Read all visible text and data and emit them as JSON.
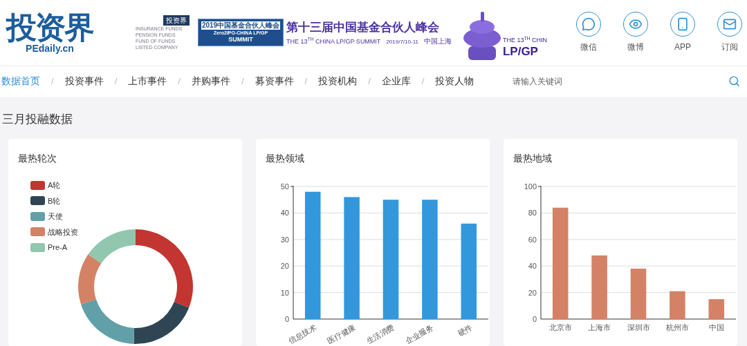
{
  "header": {
    "logo": {
      "name": "投资界",
      "site": "PEdaily.cn"
    },
    "partner": {
      "badge": "投资界",
      "lines": [
        "INSURANCE FUNDS",
        "PENSION FUNDS",
        "FUND OF FUNDS",
        "LISTED COMPANY"
      ]
    },
    "summit": {
      "badge_top": "2019中国基金合伙人峰会",
      "badge_mid": "Zero2IPO-CHINA LP/GP",
      "badge_bottom": "SUMMIT",
      "title": "第十三届中国基金合伙人峰会",
      "subtitle": "THE 13$^{TH}$ CHINA LP/GP SUMMIT",
      "date": "2019/7/10-11",
      "place": "中国上海"
    },
    "temple": {
      "line1": "THE 13$^{TH}$ CHIN",
      "line2": "LP/GP"
    },
    "links": [
      {
        "kind": "wechat",
        "label": "微信"
      },
      {
        "kind": "weibo",
        "label": "微博"
      },
      {
        "kind": "app",
        "label": "APP"
      },
      {
        "kind": "mail",
        "label": "订阅"
      }
    ]
  },
  "nav": {
    "items": [
      {
        "label": "数据首页",
        "selected": true
      },
      {
        "label": "投资事件",
        "selected": false
      },
      {
        "label": "上市事件",
        "selected": false
      },
      {
        "label": "并购事件",
        "selected": false
      },
      {
        "label": "募资事件",
        "selected": false
      },
      {
        "label": "投资机构",
        "selected": false
      },
      {
        "label": "企业库",
        "selected": false
      },
      {
        "label": "投资人物",
        "selected": false
      }
    ],
    "separator": "/",
    "search": {
      "placeholder": "请输入关键词"
    }
  },
  "section_title": "三月投融数据",
  "cards": [
    {
      "title": "最热轮次",
      "chart_data": {
        "type": "donut",
        "categories": [
          "A轮",
          "B轮",
          "天使",
          "战略投资",
          "Pre-A"
        ],
        "values": [
          31,
          19.5,
          19.5,
          14.5,
          15.5
        ],
        "colors": [
          "#c23531",
          "#2f4554",
          "#61a0a8",
          "#d48265",
          "#91c7ae"
        ],
        "legend": "top-left"
      }
    },
    {
      "title": "最热领域",
      "chart_data": {
        "type": "bar",
        "categories": [
          "信息技术",
          "医疗健康",
          "生活消费",
          "企业服务",
          "硬件"
        ],
        "series": [
          {
            "color": "#3398db",
            "values": [
              48,
              46,
              45,
              45,
              36
            ]
          }
        ],
        "ylim": [
          0,
          50
        ],
        "yticks": [
          0,
          10,
          20,
          30,
          40,
          50
        ],
        "grid": true
      }
    },
    {
      "title": "最热地域",
      "chart_data": {
        "type": "bar",
        "categories": [
          "北京市",
          "上海市",
          "深圳市",
          "杭州市",
          "中国"
        ],
        "series": [
          {
            "color": "#d48265",
            "values": [
              84,
              48,
              38,
              21,
              15
            ]
          }
        ],
        "ylim": [
          0,
          100
        ],
        "yticks": [
          0,
          20,
          40,
          60,
          80,
          100
        ],
        "grid": true
      }
    }
  ]
}
